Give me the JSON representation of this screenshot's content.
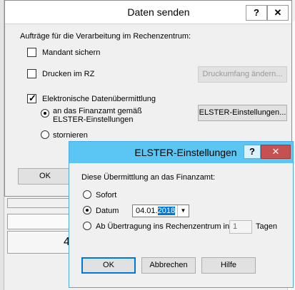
{
  "background": {
    "fragment_char": "4"
  },
  "dialog_main": {
    "title": "Daten senden",
    "help_symbol": "?",
    "close_symbol": "✕",
    "group_label": "Aufträge für die Verarbeitung im Rechenzentrum:",
    "mandant_label": "Mandant sichern",
    "mandant_checked": false,
    "drucken_label": "Drucken im RZ",
    "drucken_checked": false,
    "druckumfang_button": "Druckumfang ändern...",
    "datenuebermittlung_label": "Elektronische Datenübermittlung",
    "datenuebermittlung_checked": true,
    "finanzamt_line1": "an das Finanzamt gemäß",
    "finanzamt_line2": "ELSTER-Einstellungen",
    "elster_button": "ELSTER-Einstellungen...",
    "stornieren_label": "stornieren",
    "ok_button": "OK"
  },
  "dialog_elster": {
    "title": "ELSTER-Einstellungen",
    "help_symbol": "?",
    "close_symbol": "✕",
    "prompt": "Diese Übermittlung an das Finanzamt:",
    "option_sofort": "Sofort",
    "option_datum": "Datum",
    "option_uebertragung": "Ab Übertragung ins Rechenzentrum in",
    "selected_option": "Datum",
    "date_prefix": "04.01.",
    "date_selected": "2018",
    "days_value": "1",
    "days_unit": "Tagen",
    "ok_button": "OK",
    "cancel_button": "Abbrechen",
    "help_button": "Hilfe"
  },
  "colors": {
    "accent_titlebar": "#5bc6f3",
    "close_red": "#c75050",
    "selection": "#0078d7"
  },
  "icons": [
    "checkbox-icon",
    "radio-icon",
    "dropdown-arrow-icon",
    "help-icon",
    "close-icon"
  ]
}
